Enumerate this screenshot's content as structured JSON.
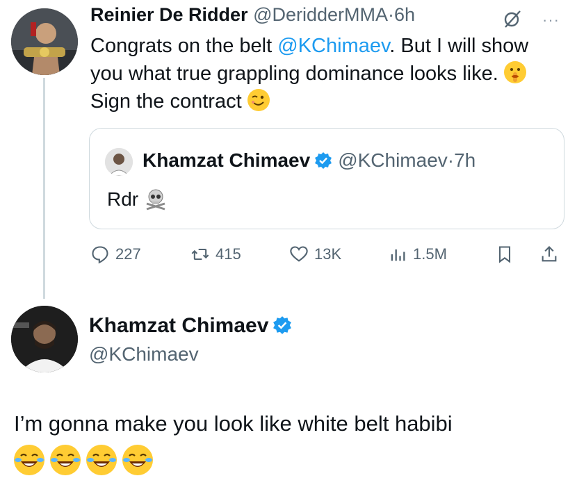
{
  "tweet1": {
    "author_name": "Reinier De Ridder",
    "author_handle": "@DeridderMMA",
    "time_sep": "·",
    "time": "6h",
    "more": "···",
    "body_part1": "Congrats on the belt ",
    "mention": "@KChimaev",
    "body_part2": ". But I will show you what true grappling dominance looks like. ",
    "emoji1": "shushing-face-emoji",
    "body_part3": " Sign the contract ",
    "emoji2": "winking-face-emoji"
  },
  "quote": {
    "author_name": "Khamzat Chimaev",
    "author_handle": "@KChimaev",
    "time_sep": "·",
    "time": "7h",
    "body": "Rdr",
    "emoji": "skull-crossbones-emoji"
  },
  "actions": {
    "replies": "227",
    "reposts": "415",
    "likes": "13K",
    "views": "1.5M"
  },
  "tweet2": {
    "author_name": "Khamzat Chimaev",
    "author_handle": "@KChimaev",
    "body": "I’m gonna make you look like white belt habibi",
    "emojis": [
      "laughing-tears-emoji",
      "laughing-tears-emoji",
      "laughing-tears-emoji",
      "laughing-tears-emoji"
    ]
  },
  "colors": {
    "link": "#1d9bf0",
    "verified": "#1d9bf0",
    "muted": "#536471",
    "border": "#cfd9de"
  }
}
